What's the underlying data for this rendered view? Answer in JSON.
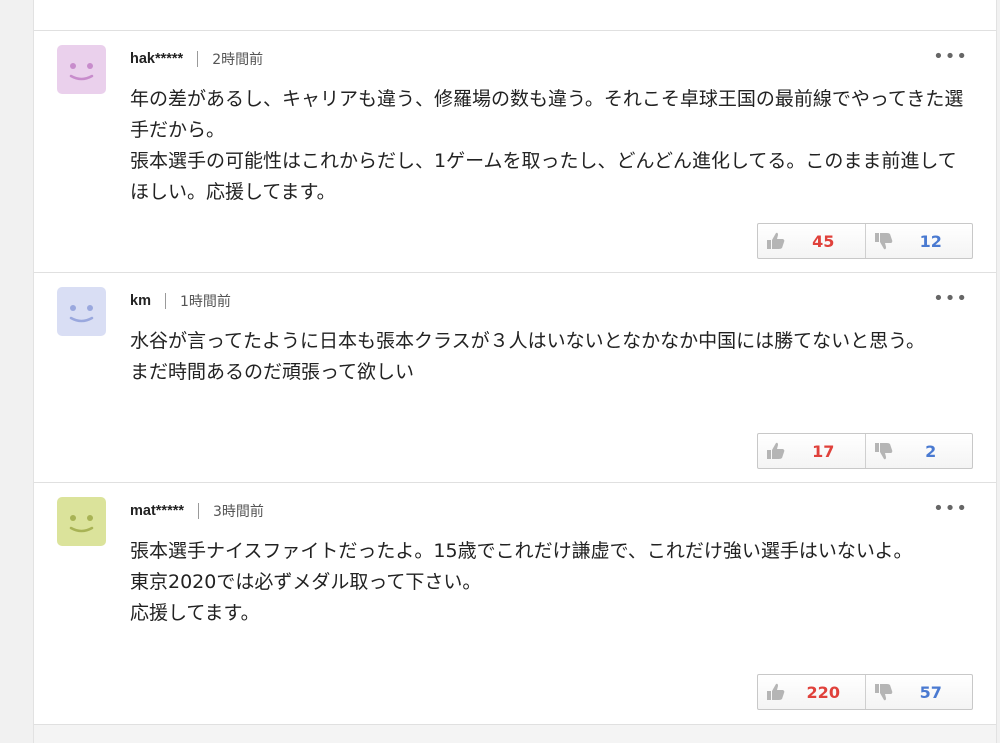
{
  "comments": [
    {
      "user": "hak*****",
      "time": "2時間前",
      "avatar_color": "#ead0ec",
      "avatar_face": "#c88ccc",
      "lines": [
        "年の差があるし、キャリアも違う、修羅場の数も違う。それこそ卓球王国の最前線でやってきた選手だから。",
        "張本選手の可能性はこれからだし、1ゲームを取ったし、どんどん進化してる。このまま前進してほしい。応援してます。"
      ],
      "likes": "45",
      "dislikes": "12"
    },
    {
      "user": "km",
      "time": "1時間前",
      "avatar_color": "#d9def4",
      "avatar_face": "#9aa8de",
      "lines": [
        "水谷が言ってたように日本も張本クラスが３人はいないとなかなか中国には勝てないと思う。",
        "まだ時間あるのだ頑張って欲しい"
      ],
      "likes": "17",
      "dislikes": "2"
    },
    {
      "user": "mat*****",
      "time": "3時間前",
      "avatar_color": "#dbe39b",
      "avatar_face": "#a8b355",
      "lines": [
        "張本選手ナイスファイトだったよ。15歳でこれだけ謙虚で、これだけ強い選手はいないよ。",
        "東京2020では必ずメダル取って下さい。",
        "応援してます。"
      ],
      "likes": "220",
      "dislikes": "57"
    }
  ]
}
